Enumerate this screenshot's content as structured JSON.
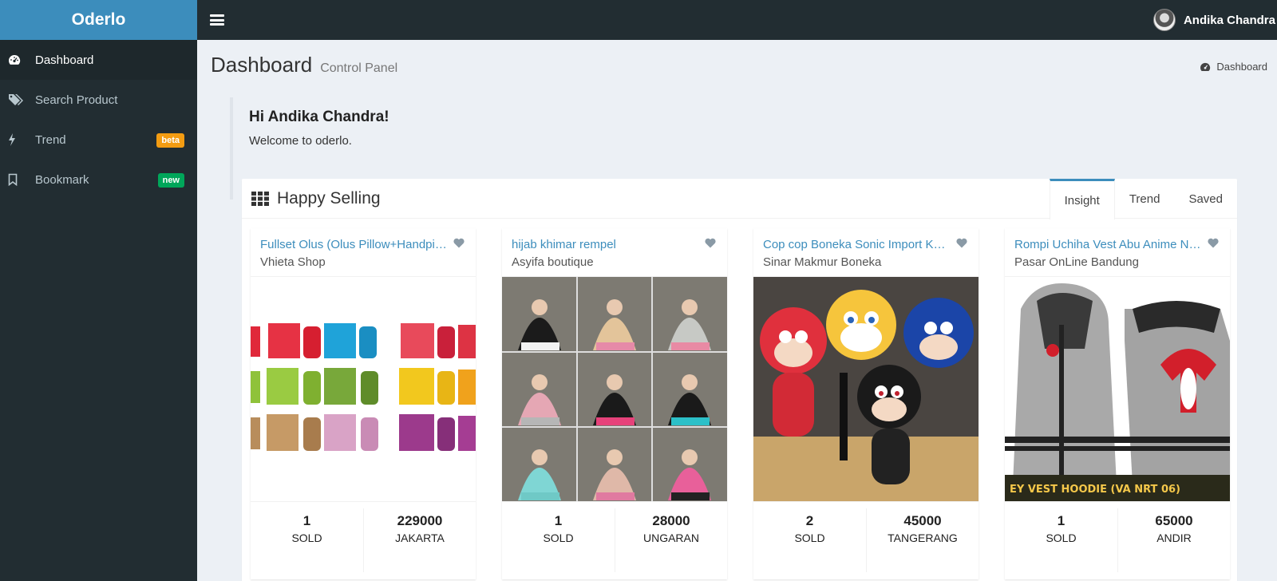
{
  "app": {
    "logo": "Oderlo"
  },
  "sidebar": {
    "items": [
      {
        "label": "Dashboard",
        "icon": "dashboard-icon",
        "active": true
      },
      {
        "label": "Search Product",
        "icon": "tags-icon"
      },
      {
        "label": "Trend",
        "icon": "bolt-icon",
        "badge": "beta",
        "badge_color": "#f39c12"
      },
      {
        "label": "Bookmark",
        "icon": "bookmark-icon",
        "badge": "new",
        "badge_color": "#00a65a"
      }
    ]
  },
  "topbar": {
    "user_name": "Andika Chandra"
  },
  "header": {
    "title": "Dashboard",
    "subtitle": "Control Panel",
    "breadcrumb": "Dashboard"
  },
  "welcome": {
    "greeting": "Hi Andika Chandra!",
    "message": "Welcome to oderlo."
  },
  "box": {
    "title": "Happy Selling",
    "tabs": [
      {
        "label": "Insight",
        "active": true
      },
      {
        "label": "Trend"
      },
      {
        "label": "Saved"
      }
    ]
  },
  "products": [
    {
      "title": "Fullset Olus (Olus Pillow+Handpillow)",
      "shop": "Vhieta Shop",
      "sold": "1",
      "sold_label": "SOLD",
      "price": "229000",
      "city": "JAKARTA"
    },
    {
      "title": "hijab khimar rempel",
      "shop": "Asyifa boutique",
      "sold": "1",
      "sold_label": "SOLD",
      "price": "28000",
      "city": "UNGARAN"
    },
    {
      "title": "Cop cop Boneka Sonic Import Keren",
      "shop": "Sinar Makmur Boneka",
      "sold": "2",
      "sold_label": "SOLD",
      "price": "45000",
      "city": "TANGERANG"
    },
    {
      "title": "Rompi Uchiha Vest Abu Anime Naruto",
      "shop": "Pasar OnLine Bandung",
      "sold": "1",
      "sold_label": "SOLD",
      "price": "65000",
      "city": "ANDIR"
    }
  ],
  "colors": {
    "sidebar_bg": "#222d32",
    "logo_bg": "#3c8dbc",
    "link": "#3c8dbc",
    "content_bg": "#ecf0f5"
  }
}
